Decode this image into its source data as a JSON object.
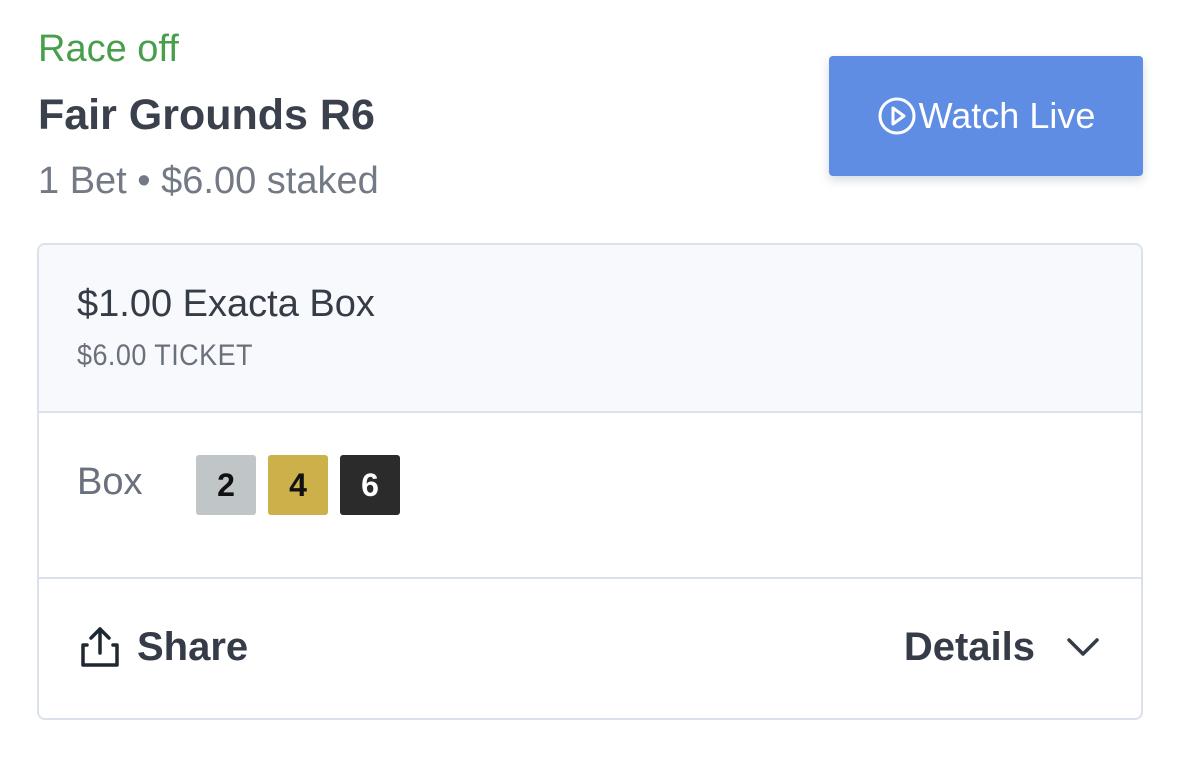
{
  "race": {
    "status": "Race off",
    "title": "Fair Grounds R6",
    "summary": "1 Bet • $6.00 staked"
  },
  "watch_live": {
    "label": "Watch Live",
    "icon": "play-circle-icon",
    "color": "#5f8de4"
  },
  "bet": {
    "type": "$1.00 Exacta Box",
    "ticket": "$6.00 TICKET",
    "selection_label": "Box",
    "runners": [
      {
        "number": "2",
        "bg": "#c0c6c7",
        "fg": "#111111"
      },
      {
        "number": "4",
        "bg": "#ccb04a",
        "fg": "#111111"
      },
      {
        "number": "6",
        "bg": "#2b2b2b",
        "fg": "#ffffff"
      }
    ]
  },
  "actions": {
    "share_label": "Share",
    "share_icon": "share-upload-icon",
    "details_label": "Details",
    "details_icon": "chevron-down-icon"
  },
  "colors": {
    "status_green": "#479f4b",
    "text_dark": "#353c47",
    "text_muted": "#737a85",
    "border": "#dbe1ea",
    "card_head_bg": "#f8f9fc"
  }
}
